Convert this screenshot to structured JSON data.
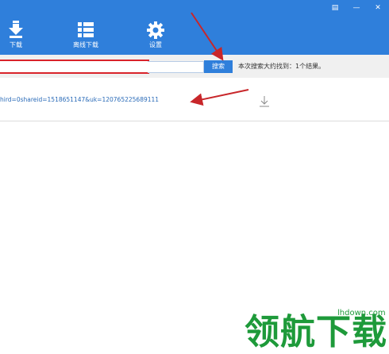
{
  "toolbar": {
    "download_label": "下载",
    "offline_download_label": "离线下载",
    "settings_label": "设置"
  },
  "window_controls": [
    "▤",
    "—",
    "✕"
  ],
  "search": {
    "value": "",
    "button_label": "搜索",
    "result_summary": "本次搜索大约找到：1个结果。"
  },
  "results": [
    {
      "link_text": "hird=0shareid=1518651147&uk=120765225689111"
    }
  ],
  "watermark": {
    "text": "领航下载",
    "url": "lhdown.com"
  },
  "colors": {
    "toolbar": "#2f7fdb",
    "highlight": "#d9232a",
    "annotation_arrow": "#c8262a",
    "watermark": "#1e9a3a"
  }
}
